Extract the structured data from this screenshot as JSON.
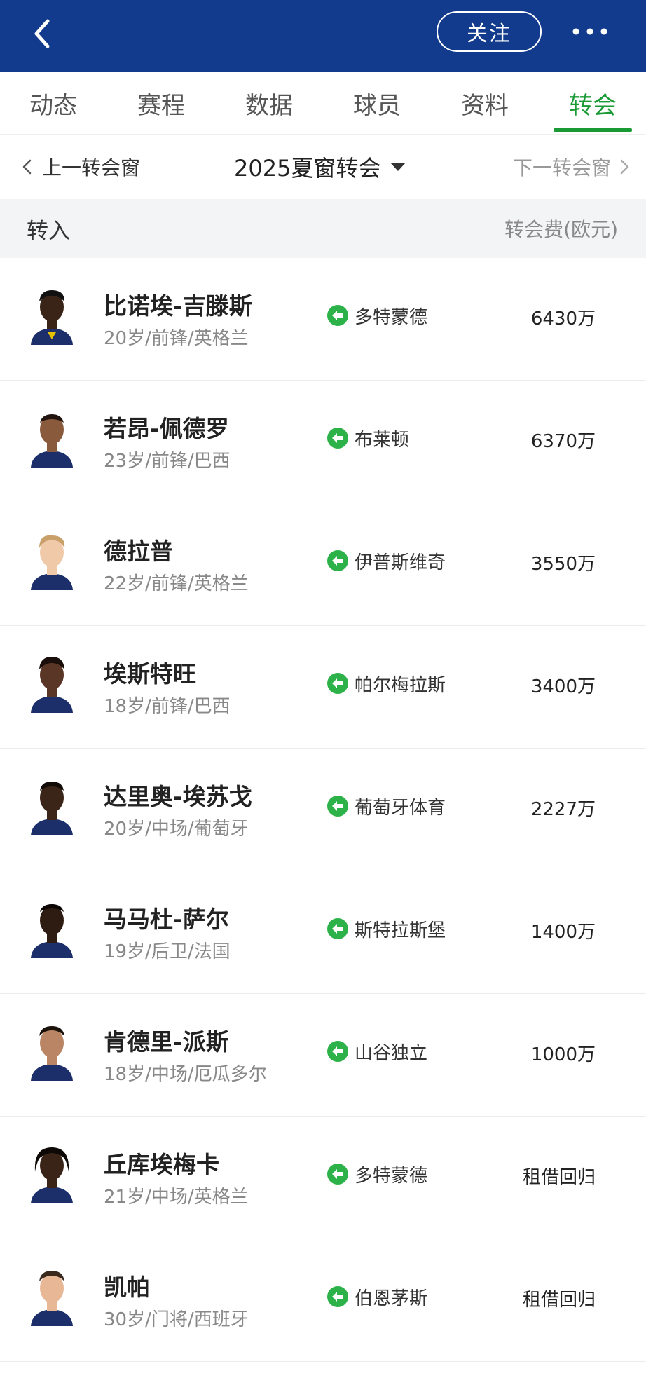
{
  "header": {
    "follow_label": "关注",
    "back_icon": "chevron-left-icon",
    "more_icon": "more-dots-icon",
    "bg_color": "#133b8d"
  },
  "tabs": [
    {
      "label": "动态"
    },
    {
      "label": "赛程"
    },
    {
      "label": "数据"
    },
    {
      "label": "球员"
    },
    {
      "label": "资料"
    },
    {
      "label": "转会",
      "active": true
    }
  ],
  "accent_color": "#1a9a35",
  "window": {
    "prev_label": "上一转会窗",
    "current_label": "2025夏窗转会",
    "next_label": "下一转会窗"
  },
  "section": {
    "title": "转入",
    "fee_header": "转会费(欧元)"
  },
  "players": [
    {
      "name": "比诺埃-吉滕斯",
      "info": "20岁/前锋/英格兰",
      "from_club": "多特蒙德",
      "fee": "6430万"
    },
    {
      "name": "若昂-佩德罗",
      "info": "23岁/前锋/巴西",
      "from_club": "布莱顿",
      "fee": "6370万"
    },
    {
      "name": "德拉普",
      "info": "22岁/前锋/英格兰",
      "from_club": "伊普斯维奇",
      "fee": "3550万"
    },
    {
      "name": "埃斯特旺",
      "info": "18岁/前锋/巴西",
      "from_club": "帕尔梅拉斯",
      "fee": "3400万"
    },
    {
      "name": "达里奥-埃苏戈",
      "info": "20岁/中场/葡萄牙",
      "from_club": "葡萄牙体育",
      "fee": "2227万"
    },
    {
      "name": "马马杜-萨尔",
      "info": "19岁/后卫/法国",
      "from_club": "斯特拉斯堡",
      "fee": "1400万"
    },
    {
      "name": "肯德里-派斯",
      "info": "18岁/中场/厄瓜多尔",
      "from_club": "山谷独立",
      "fee": "1000万"
    },
    {
      "name": "丘库埃梅卡",
      "info": "21岁/中场/英格兰",
      "from_club": "多特蒙德",
      "fee": "租借回归"
    },
    {
      "name": "凯帕",
      "info": "30岁/门将/西班牙",
      "from_club": "伯恩茅斯",
      "fee": "租借回归"
    }
  ]
}
